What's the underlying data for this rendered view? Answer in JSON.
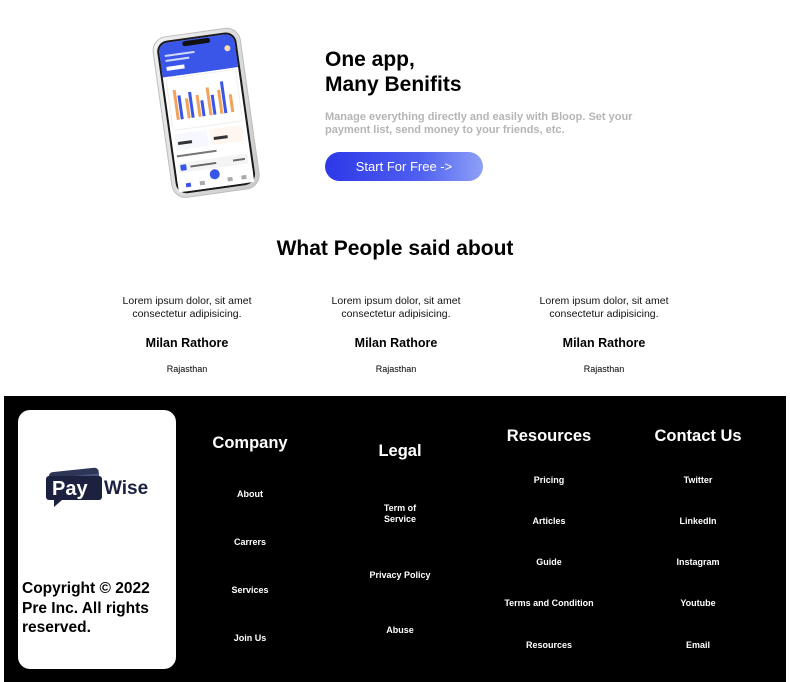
{
  "hero": {
    "title_line1": "One app,",
    "title_line2": "Many Benifits",
    "description": "Manage everything directly and easily with Bloop. Set your payment list, send money to your friends, etc.",
    "cta_label": "Start For Free ->"
  },
  "testimonials": {
    "title": "What People said about",
    "items": [
      {
        "quote": "Lorem ipsum dolor, sit amet consectetur adipisicing.",
        "name": "Milan Rathore",
        "place": "Rajasthan"
      },
      {
        "quote": "Lorem ipsum dolor, sit amet consectetur adipisicing.",
        "name": "Milan Rathore",
        "place": "Rajasthan"
      },
      {
        "quote": "Lorem ipsum dolor, sit amet consectetur adipisicing.",
        "name": "Milan Rathore",
        "place": "Rajasthan"
      }
    ]
  },
  "footer": {
    "logo": {
      "part1": "Pay",
      "part2": "Wise"
    },
    "copyright": "Copyright © 2022 Pre Inc. All rights reserved.",
    "company": {
      "heading": "Company",
      "items": [
        "About",
        "Carrers",
        "Services",
        "Join Us"
      ]
    },
    "legal": {
      "heading": "Legal",
      "items": [
        "Term of Service",
        "Privacy Policy",
        "Abuse"
      ]
    },
    "resources": {
      "heading": "Resources",
      "items": [
        "Pricing",
        "Articles",
        "Guide",
        "Terms and Condition",
        "Resources"
      ]
    },
    "contact": {
      "heading": "Contact Us",
      "items": [
        "Twitter",
        "LinkedIn",
        "Instagram",
        "Youtube",
        "Email"
      ]
    }
  },
  "colors": {
    "accent": "#3344ee",
    "footer_bg": "#000000",
    "muted_text": "#b5b5b5",
    "logo_dark": "#1c2140"
  }
}
